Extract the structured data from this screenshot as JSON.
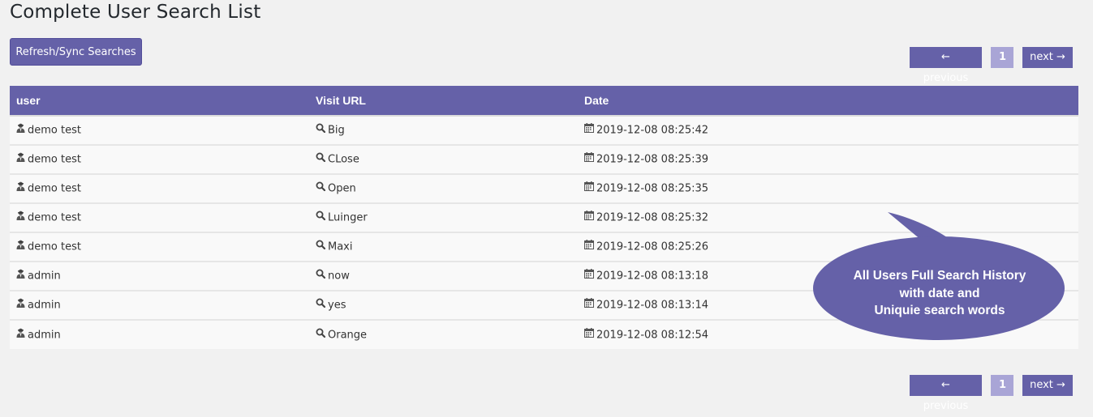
{
  "page": {
    "title": "Complete User Search List",
    "refresh_label": "Refresh/Sync Searches"
  },
  "pagination": {
    "prev_label": "← previous",
    "current_page": "1",
    "next_label": "next →"
  },
  "table": {
    "columns": [
      "user",
      "Visit URL",
      "Date"
    ],
    "rows": [
      {
        "user": "demo test",
        "url": "Big",
        "date": "2019-12-08 08:25:42"
      },
      {
        "user": "demo test",
        "url": "CLose",
        "date": "2019-12-08 08:25:39"
      },
      {
        "user": "demo test",
        "url": "Open",
        "date": "2019-12-08 08:25:35"
      },
      {
        "user": "demo test",
        "url": "Luinger",
        "date": "2019-12-08 08:25:32"
      },
      {
        "user": "demo test",
        "url": "Maxi",
        "date": "2019-12-08 08:25:26"
      },
      {
        "user": "admin",
        "url": "now",
        "date": "2019-12-08 08:13:18"
      },
      {
        "user": "admin",
        "url": "yes",
        "date": "2019-12-08 08:13:14"
      },
      {
        "user": "admin",
        "url": "Orange",
        "date": "2019-12-08 08:12:54"
      }
    ],
    "icons": {
      "user": "user-secret-icon",
      "url": "search-icon",
      "date": "calendar-icon"
    }
  },
  "callout": {
    "line1": "All Users Full Search History",
    "line2": "with date and",
    "line3": "Uniquie search words"
  },
  "colors": {
    "accent": "#6561a8",
    "page_bg": "#f1f1f1",
    "active_page": "#a9a5d6"
  }
}
